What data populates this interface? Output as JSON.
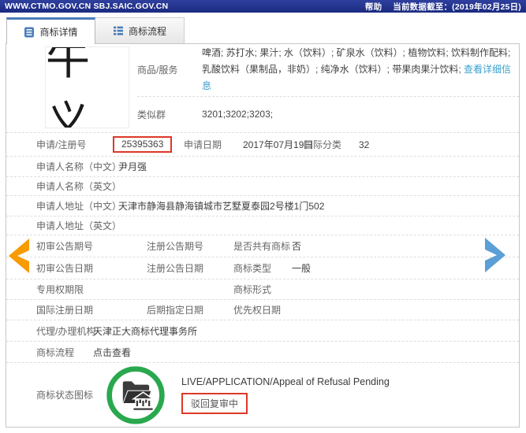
{
  "header": {
    "site": "WWW.CTMO.GOV.CN SBJ.SAIC.GOV.CN",
    "help": "帮助",
    "data_date": "当前数据截至：(2019年02月25日)"
  },
  "tabs": {
    "details": "商标详情",
    "process": "商标流程"
  },
  "mark": {
    "image_text": "牛义"
  },
  "goods": {
    "label": "商品/服务",
    "value": "啤酒; 苏打水; 果汁; 水（饮料）; 矿泉水（饮料）; 植物饮料; 饮料制作配料; 乳酸饮料（果制品，非奶）; 纯净水（饮料）; 带果肉果汁饮料; ",
    "link": "查看详细信息"
  },
  "similar_group": {
    "label": "类似群",
    "value": "3201;3202;3203;"
  },
  "fields": {
    "reg_no": {
      "label": "申请/注册号",
      "value": "25395363"
    },
    "app_date": {
      "label": "申请日期",
      "value": "2017年07月19日"
    },
    "intl_class": {
      "label": "国际分类",
      "value": "32"
    },
    "applicant_name_cn": {
      "label": "申请人名称（中文）",
      "value": "尹月强"
    },
    "applicant_name_en": {
      "label": "申请人名称（英文）",
      "value": ""
    },
    "applicant_addr_cn": {
      "label": "申请人地址（中文）",
      "value": "天津市静海县静海镇城市艺墅夏泰园2号楼1门502"
    },
    "applicant_addr_en": {
      "label": "申请人地址（英文）",
      "value": ""
    },
    "first_notice_no": {
      "label": "初审公告期号",
      "value": ""
    },
    "reg_notice_no": {
      "label": "注册公告期号",
      "value": ""
    },
    "is_shared": {
      "label": "是否共有商标",
      "value": "否"
    },
    "first_notice_date": {
      "label": "初审公告日期",
      "value": ""
    },
    "reg_notice_date": {
      "label": "注册公告日期",
      "value": ""
    },
    "mark_type": {
      "label": "商标类型",
      "value": "一般"
    },
    "exclusive_period": {
      "label": "专用权期限",
      "value": ""
    },
    "mark_form": {
      "label": "商标形式",
      "value": ""
    },
    "intl_reg_date": {
      "label": "国际注册日期",
      "value": ""
    },
    "later_designation_date": {
      "label": "后期指定日期",
      "value": ""
    },
    "priority_date": {
      "label": "优先权日期",
      "value": ""
    },
    "agency": {
      "label": "代理/办理机构",
      "value": "天津正大商标代理事务所"
    },
    "process": {
      "label": "商标流程",
      "link": "点击查看"
    },
    "status": {
      "label": "商标状态图标",
      "status_en": "LIVE/APPLICATION/Appeal of Refusal Pending",
      "status_cn": "驳回复审中"
    }
  },
  "colors": {
    "topbar_blue": "#21309a",
    "tab_accent_blue": "#4a7ebb",
    "link_blue": "#39a0cb",
    "highlight_red": "#dd3826",
    "status_green": "#2aa84e",
    "arrow_orange": "#f79b00",
    "arrow_blue": "#5b9fd6"
  }
}
